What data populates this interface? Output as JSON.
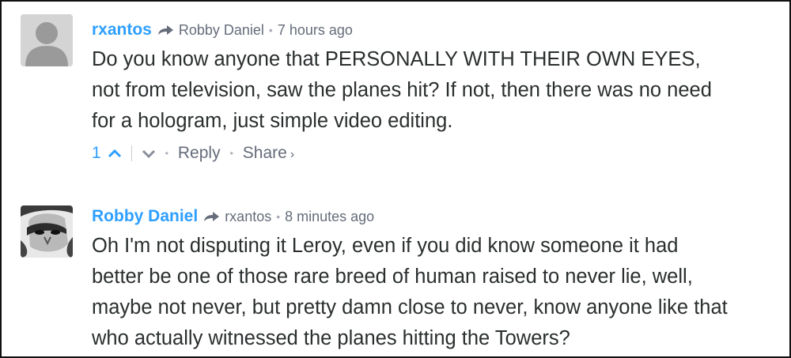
{
  "comments": [
    {
      "author": "rxantos",
      "reply_to": "Robby Daniel",
      "time": "7 hours ago",
      "message": "Do you know anyone that PERSONALLY WITH THEIR OWN EYES,\nnot from television, saw the planes hit? If not, then there was no need\nfor a hologram, just simple video editing.",
      "upvotes": "1",
      "reply_label": "Reply",
      "share_label": "Share",
      "share_chevron": "›",
      "avatar": "default-avatar-icon"
    },
    {
      "author": "Robby Daniel",
      "reply_to": "rxantos",
      "time": "8 minutes ago",
      "message": "Oh I'm not disputing it Leroy, even if you did know someone it had\nbetter be one of those rare breed of human raised to never lie, well,\nmaybe not never, but pretty damn close to never, know anyone like that\nwho actually witnessed the planes hitting the Towers?",
      "avatar": "user-photo"
    }
  ],
  "colors": {
    "author": "#2e9fff",
    "meta": "#656c7a",
    "text": "#2a2e2e"
  }
}
